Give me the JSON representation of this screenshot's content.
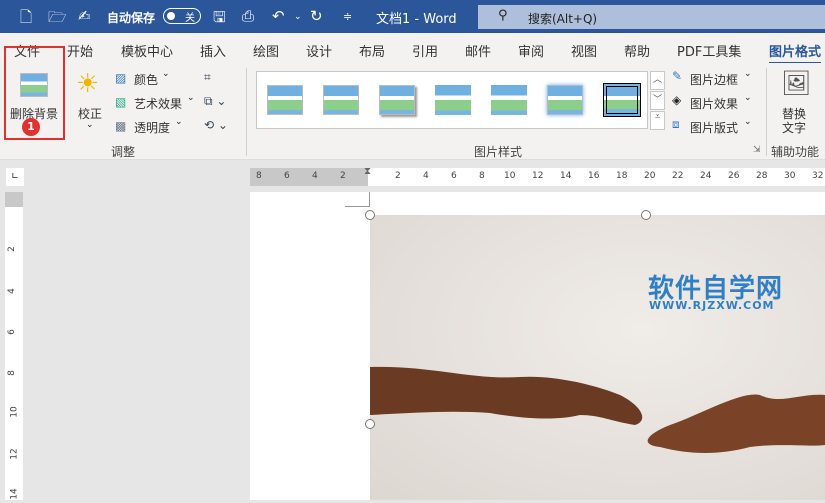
{
  "titlebar": {
    "autosave_label": "自动保存",
    "toggle_state": "关",
    "doc_title": "文档1 - Word",
    "search_placeholder": "搜索(Alt+Q)"
  },
  "tabs": [
    "文件",
    "开始",
    "模板中心",
    "插入",
    "绘图",
    "设计",
    "布局",
    "引用",
    "邮件",
    "审阅",
    "视图",
    "帮助",
    "PDF工具集",
    "图片格式"
  ],
  "active_tab": "图片格式",
  "ribbon": {
    "remove_bg": "删除背景",
    "badge": "1",
    "corrections": "校正",
    "color": "颜色",
    "artistic": "艺术效果",
    "transparency": "透明度",
    "adjust_group": "调整",
    "styles_group": "图片样式",
    "border": "图片边框",
    "effects": "图片效果",
    "layout": "图片版式",
    "alt_text_1": "替换",
    "alt_text_2": "文字",
    "access_group": "辅助功能"
  },
  "ruler": {
    "h_neg": [
      "8",
      "6",
      "4",
      "2"
    ],
    "h_pos": [
      "2",
      "4",
      "6",
      "8",
      "10",
      "12",
      "14",
      "16",
      "18",
      "20",
      "22",
      "24",
      "26",
      "28",
      "30",
      "32"
    ],
    "v": [
      "2",
      "4",
      "6",
      "8",
      "10",
      "12",
      "14"
    ]
  },
  "watermark": {
    "cn": "软件自学网",
    "url": "WWW.RJZXW.COM"
  }
}
